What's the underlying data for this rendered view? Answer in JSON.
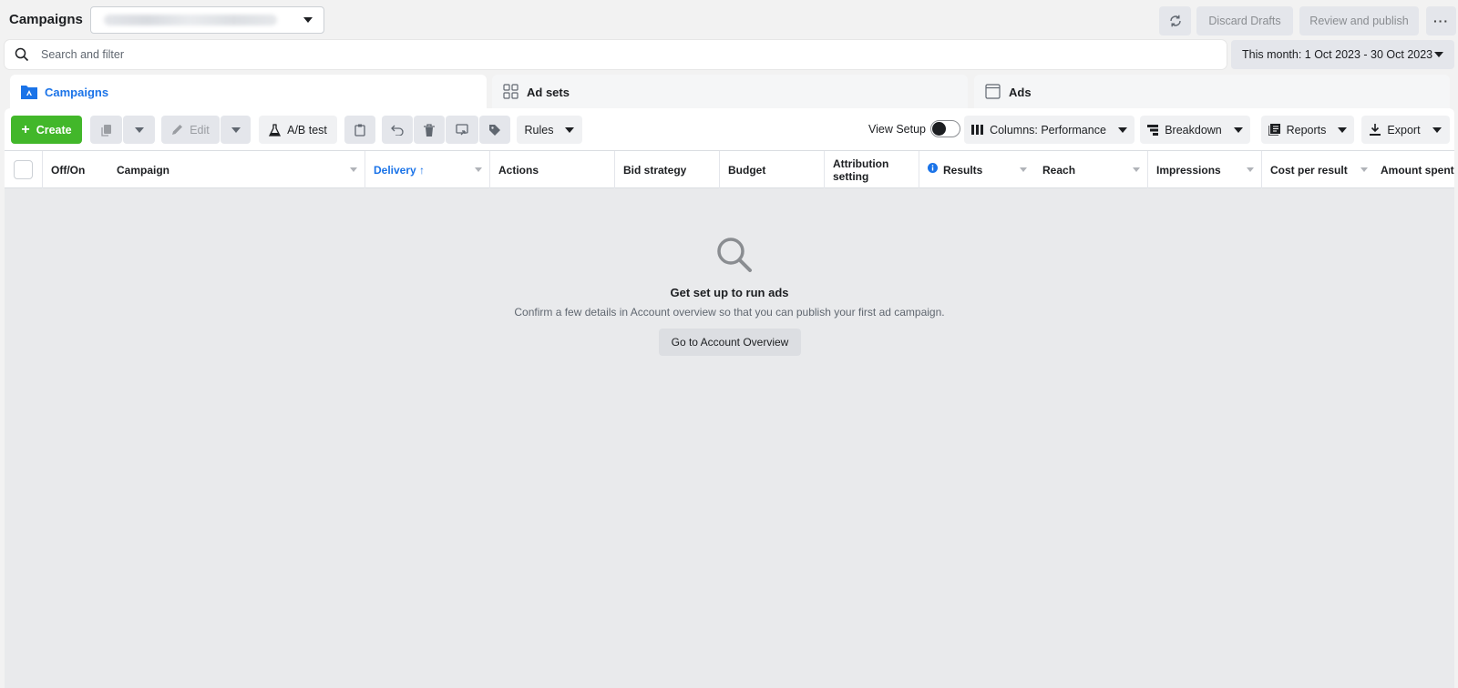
{
  "header": {
    "title": "Campaigns",
    "account_select": "",
    "discard_label": "Discard Drafts",
    "review_label": "Review and publish",
    "more_label": "···"
  },
  "search": {
    "placeholder": "Search and filter"
  },
  "date_range": "This month: 1 Oct 2023 - 30 Oct 2023",
  "tabs": [
    {
      "label": "Campaigns",
      "active": true
    },
    {
      "label": "Ad sets",
      "active": false
    },
    {
      "label": "Ads",
      "active": false
    }
  ],
  "toolbar": {
    "create_label": "Create",
    "edit_label": "Edit",
    "ab_test_label": "A/B test",
    "rules_label": "Rules",
    "view_setup_label": "View Setup",
    "columns_label": "Columns: Performance",
    "breakdown_label": "Breakdown",
    "reports_label": "Reports",
    "export_label": "Export"
  },
  "columns": [
    {
      "label": "Off/On"
    },
    {
      "label": "Campaign"
    },
    {
      "label": "Delivery ↑"
    },
    {
      "label": "Actions"
    },
    {
      "label": "Bid strategy"
    },
    {
      "label": "Budget"
    },
    {
      "label": "Attribution setting"
    },
    {
      "label": "Results"
    },
    {
      "label": "Reach"
    },
    {
      "label": "Impressions"
    },
    {
      "label": "Cost per result"
    },
    {
      "label": "Amount spent"
    }
  ],
  "empty_state": {
    "title": "Get set up to run ads",
    "description": "Confirm a few details in Account overview so that you can publish your first ad campaign.",
    "button_label": "Go to Account Overview"
  },
  "colors": {
    "accent": "#1a73e8",
    "create": "#42b72a"
  }
}
